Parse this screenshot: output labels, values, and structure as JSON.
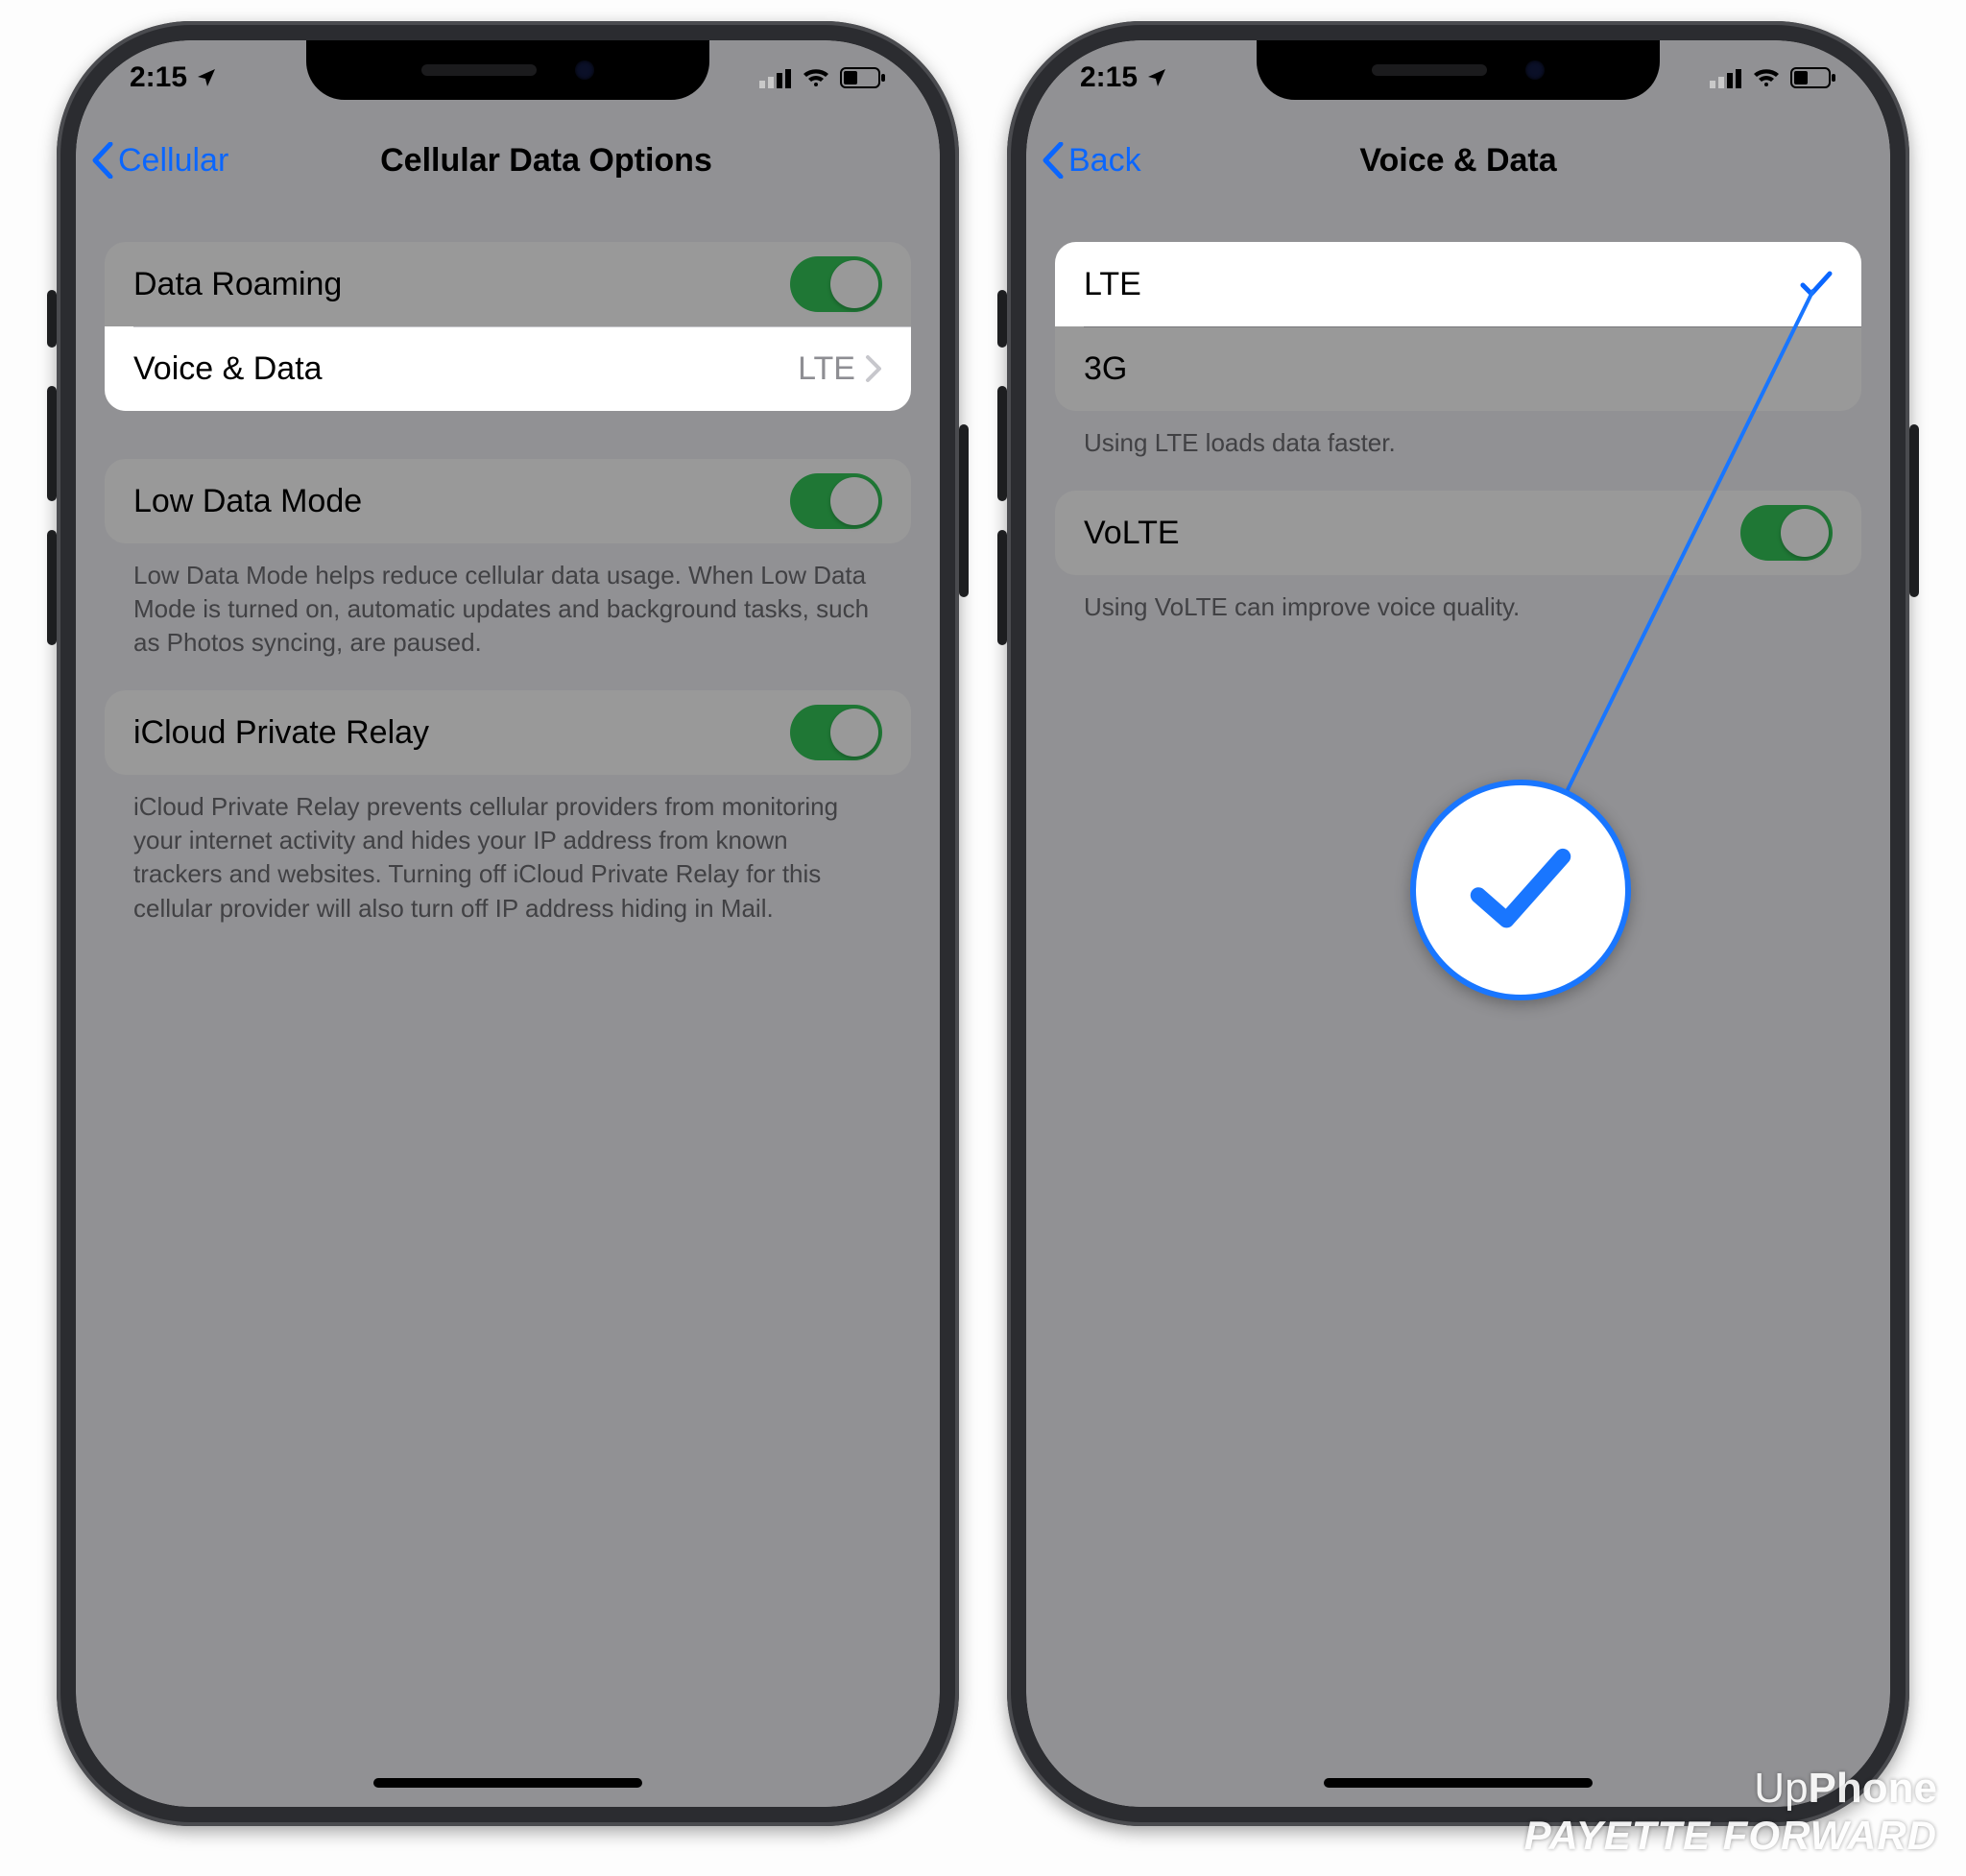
{
  "status": {
    "time": "2:15"
  },
  "left": {
    "back": "Cellular",
    "title": "Cellular Data Options",
    "rows": {
      "data_roaming": "Data Roaming",
      "voice_data": "Voice & Data",
      "voice_data_value": "LTE",
      "low_data": "Low Data Mode",
      "low_data_footer": "Low Data Mode helps reduce cellular data usage. When Low Data Mode is turned on, automatic updates and background tasks, such as Photos syncing, are paused.",
      "relay": "iCloud Private Relay",
      "relay_footer": "iCloud Private Relay prevents cellular providers from monitoring your internet activity and hides your IP address from known trackers and websites. Turning off iCloud Private Relay for this cellular provider will also turn off IP address hiding in Mail."
    }
  },
  "right": {
    "back": "Back",
    "title": "Voice & Data",
    "rows": {
      "lte": "LTE",
      "g3": "3G",
      "net_footer": "Using LTE loads data faster.",
      "volte": "VoLTE",
      "volte_footer": "Using VoLTE can improve voice quality."
    }
  },
  "watermark": {
    "line1a": "Up",
    "line1b": "Phone",
    "line2": "PAYETTE FORWARD"
  }
}
